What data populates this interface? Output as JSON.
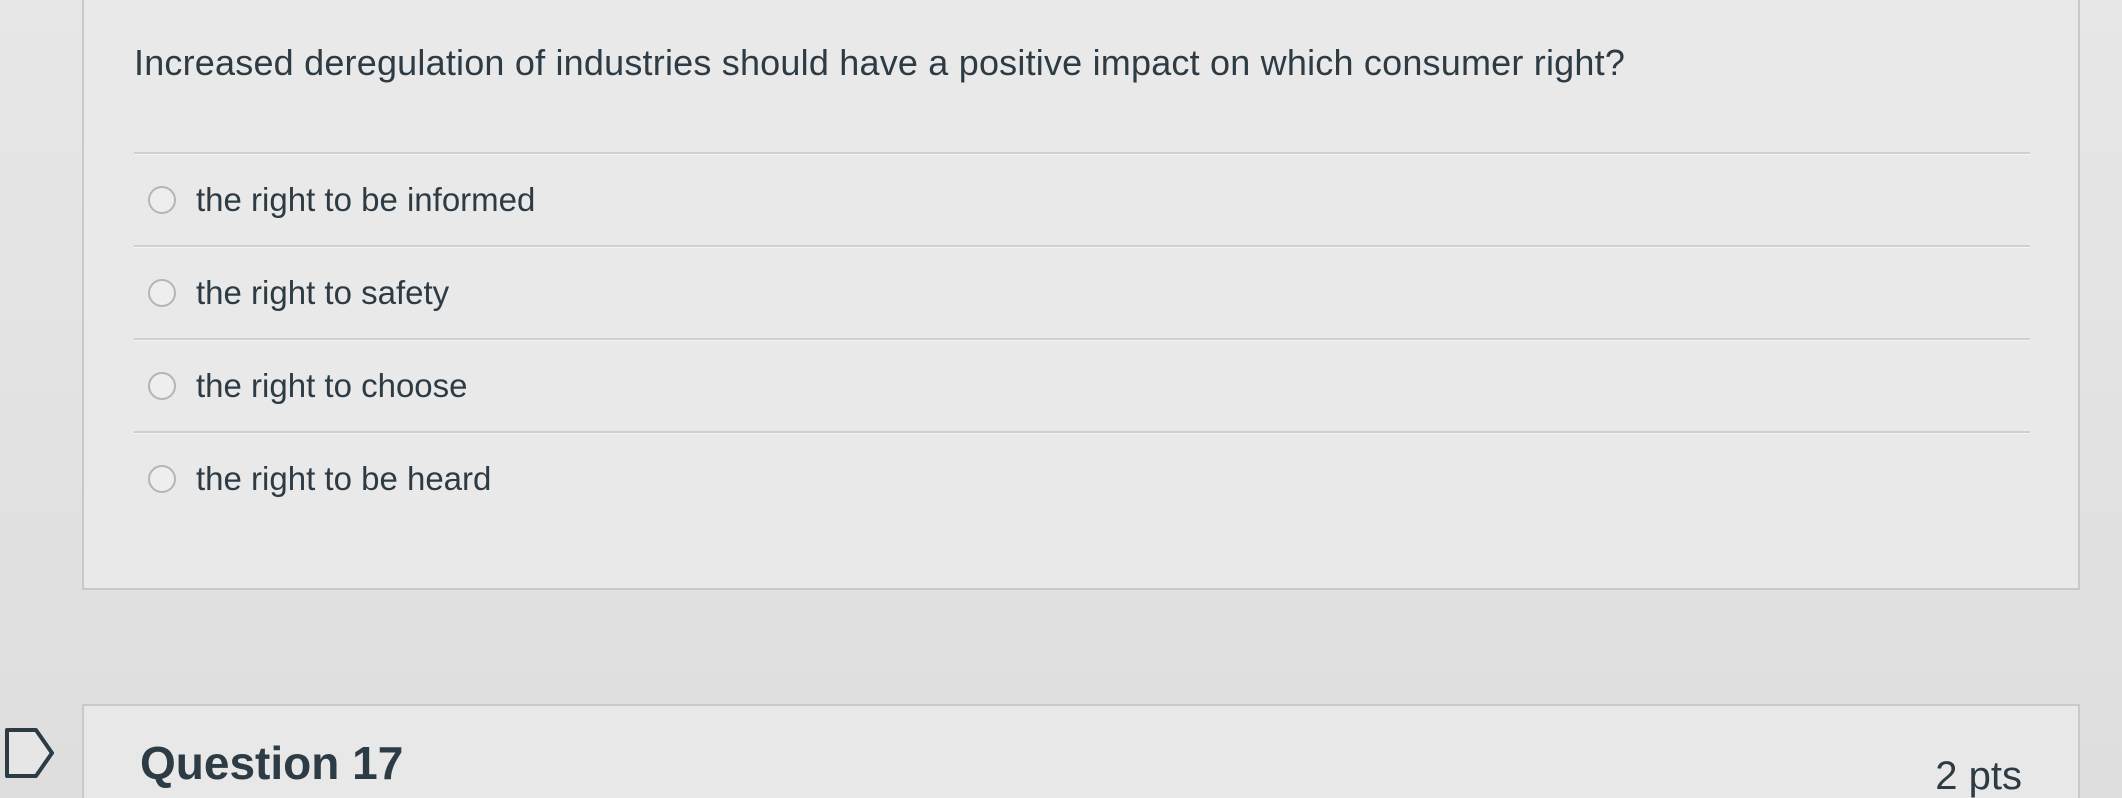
{
  "question": {
    "text": "Increased deregulation of industries should have a positive impact on which consumer right?",
    "answers": [
      {
        "label": "the right to be informed"
      },
      {
        "label": "the right to safety"
      },
      {
        "label": "the right to choose"
      },
      {
        "label": "the right to be heard"
      }
    ]
  },
  "next_question": {
    "title": "Question 17",
    "points": "2 pts",
    "marker_icon": "flag-marker-icon"
  }
}
